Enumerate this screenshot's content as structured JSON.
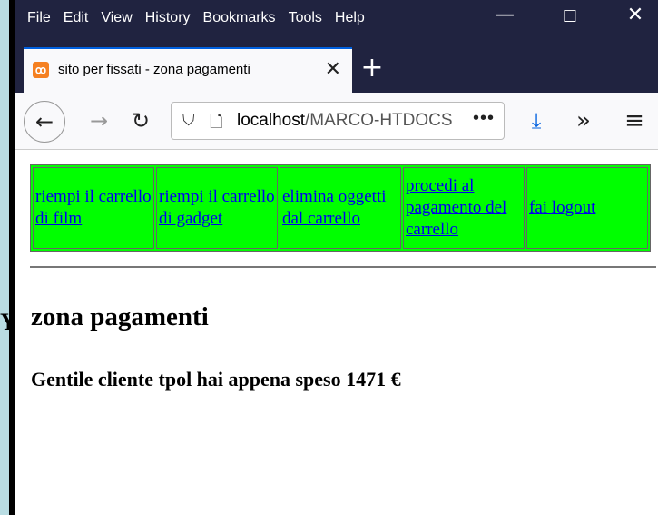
{
  "background": {
    "partial_heading": "Y"
  },
  "browser": {
    "menu": [
      "File",
      "Edit",
      "View",
      "History",
      "Bookmarks",
      "Tools",
      "Help"
    ],
    "tab_title": "sito per fissati - zona pagamenti",
    "url_host": "localhost",
    "url_path": "/MARCO-HTDOCS",
    "colors": {
      "title_bar": "#202340",
      "accent": "#0060df"
    }
  },
  "page": {
    "nav_links": [
      "riempi il carrello di film",
      "riempi il carrello di gadget",
      "elimina oggetti dal carrello",
      "procedi al pagamento del carrello",
      "fai logout"
    ],
    "heading": "zona pagamenti",
    "message": "Gentile cliente tpol hai appena speso 1471 €",
    "colors": {
      "nav_background": "#00ff00"
    }
  }
}
